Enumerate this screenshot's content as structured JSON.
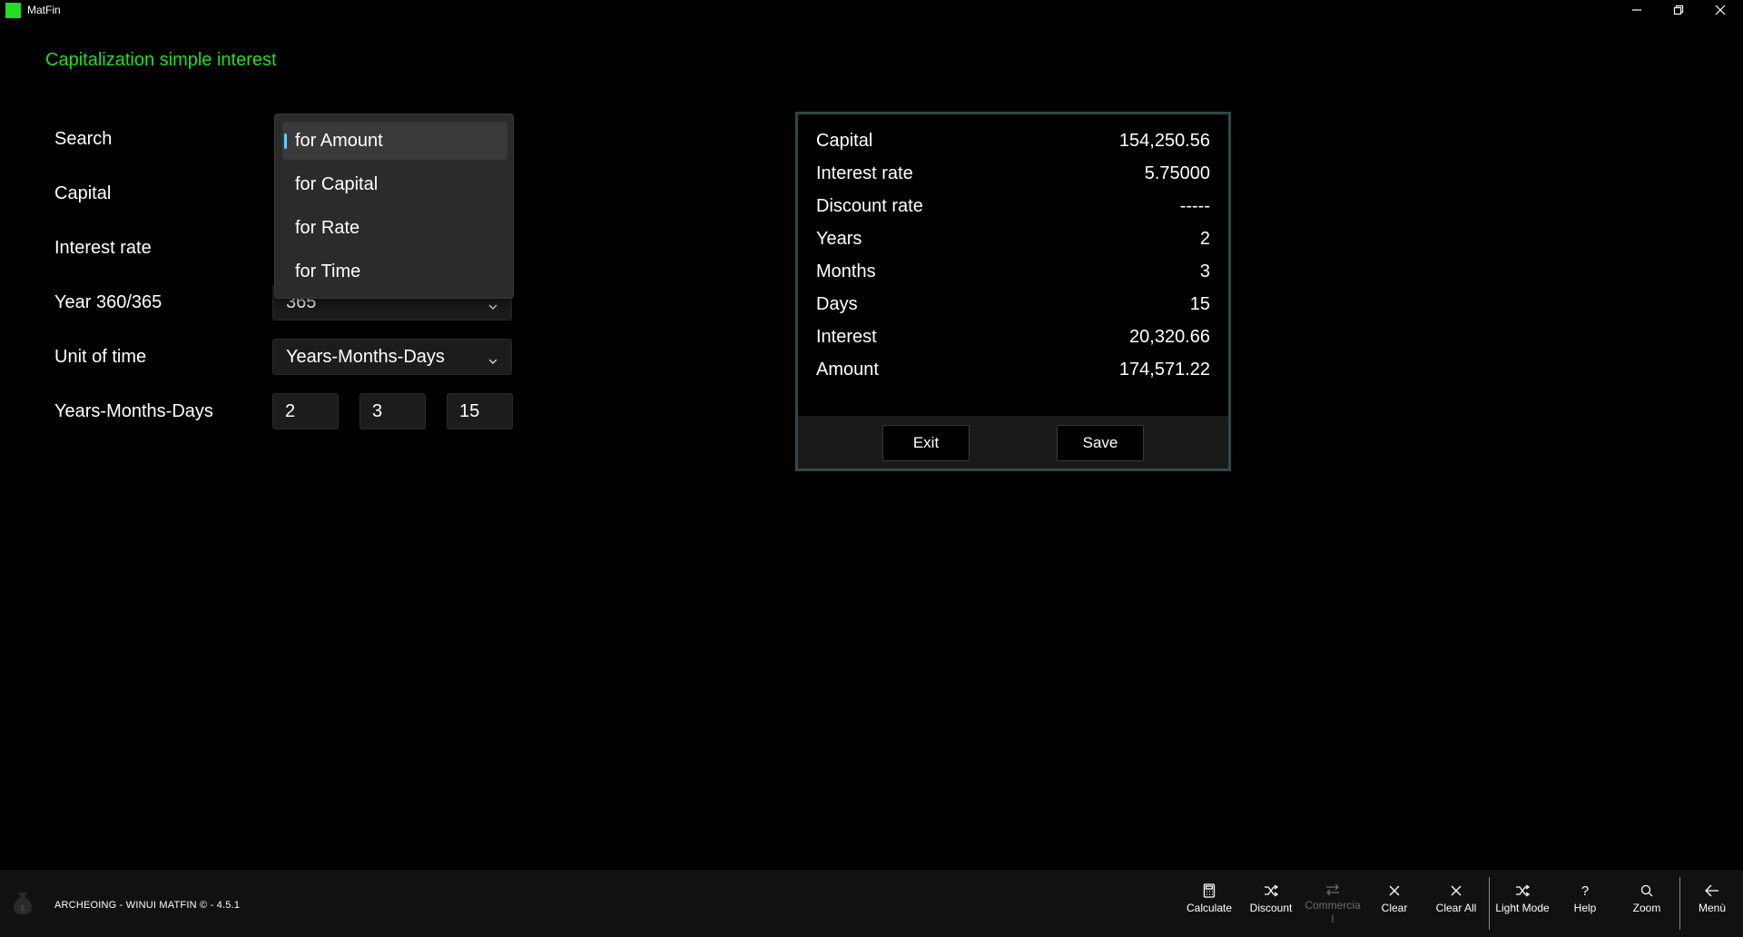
{
  "window": {
    "title": "MatFin",
    "icon_color": "#22dd22"
  },
  "page": {
    "title": "Capitalization simple interest"
  },
  "form": {
    "search_label": "Search",
    "capital_label": "Capital",
    "interest_rate_label": "Interest rate",
    "year_basis_label": "Year 360/365",
    "year_basis_value": "365",
    "unit_of_time_label": "Unit of time",
    "unit_of_time_value": "Years-Months-Days",
    "ymd_label": "Years-Months-Days",
    "years_value": "2",
    "months_value": "3",
    "days_value": "15"
  },
  "search_dropdown": {
    "selected": "for Amount",
    "options": [
      "for Amount",
      "for Capital",
      "for Rate",
      "for Time"
    ]
  },
  "results": {
    "rows": [
      {
        "label": "Capital",
        "value": "154,250.56"
      },
      {
        "label": "Interest rate",
        "value": "5.75000"
      },
      {
        "label": "Discount rate",
        "value": "-----"
      },
      {
        "label": "Years",
        "value": "2"
      },
      {
        "label": "Months",
        "value": "3"
      },
      {
        "label": "Days",
        "value": "15"
      },
      {
        "label": "Interest",
        "value": "20,320.66"
      },
      {
        "label": "Amount",
        "value": "174,571.22"
      }
    ],
    "exit_label": "Exit",
    "save_label": "Save",
    "border_color": "#2c4a48"
  },
  "footer": {
    "app_info": "ARCHEOING - WINUI MATFIN © - 4.5.1"
  },
  "command_bar": {
    "calculate": "Calculate",
    "discount": "Discount",
    "commercial": "Commercia\nl",
    "clear": "Clear",
    "clear_all": "Clear All",
    "light_mode": "Light Mode",
    "help": "Help",
    "zoom": "Zoom",
    "menu": "Menù"
  },
  "colors": {
    "accent_green": "#22dd22",
    "selection_indicator": "#60cdff",
    "background": "#000000"
  }
}
